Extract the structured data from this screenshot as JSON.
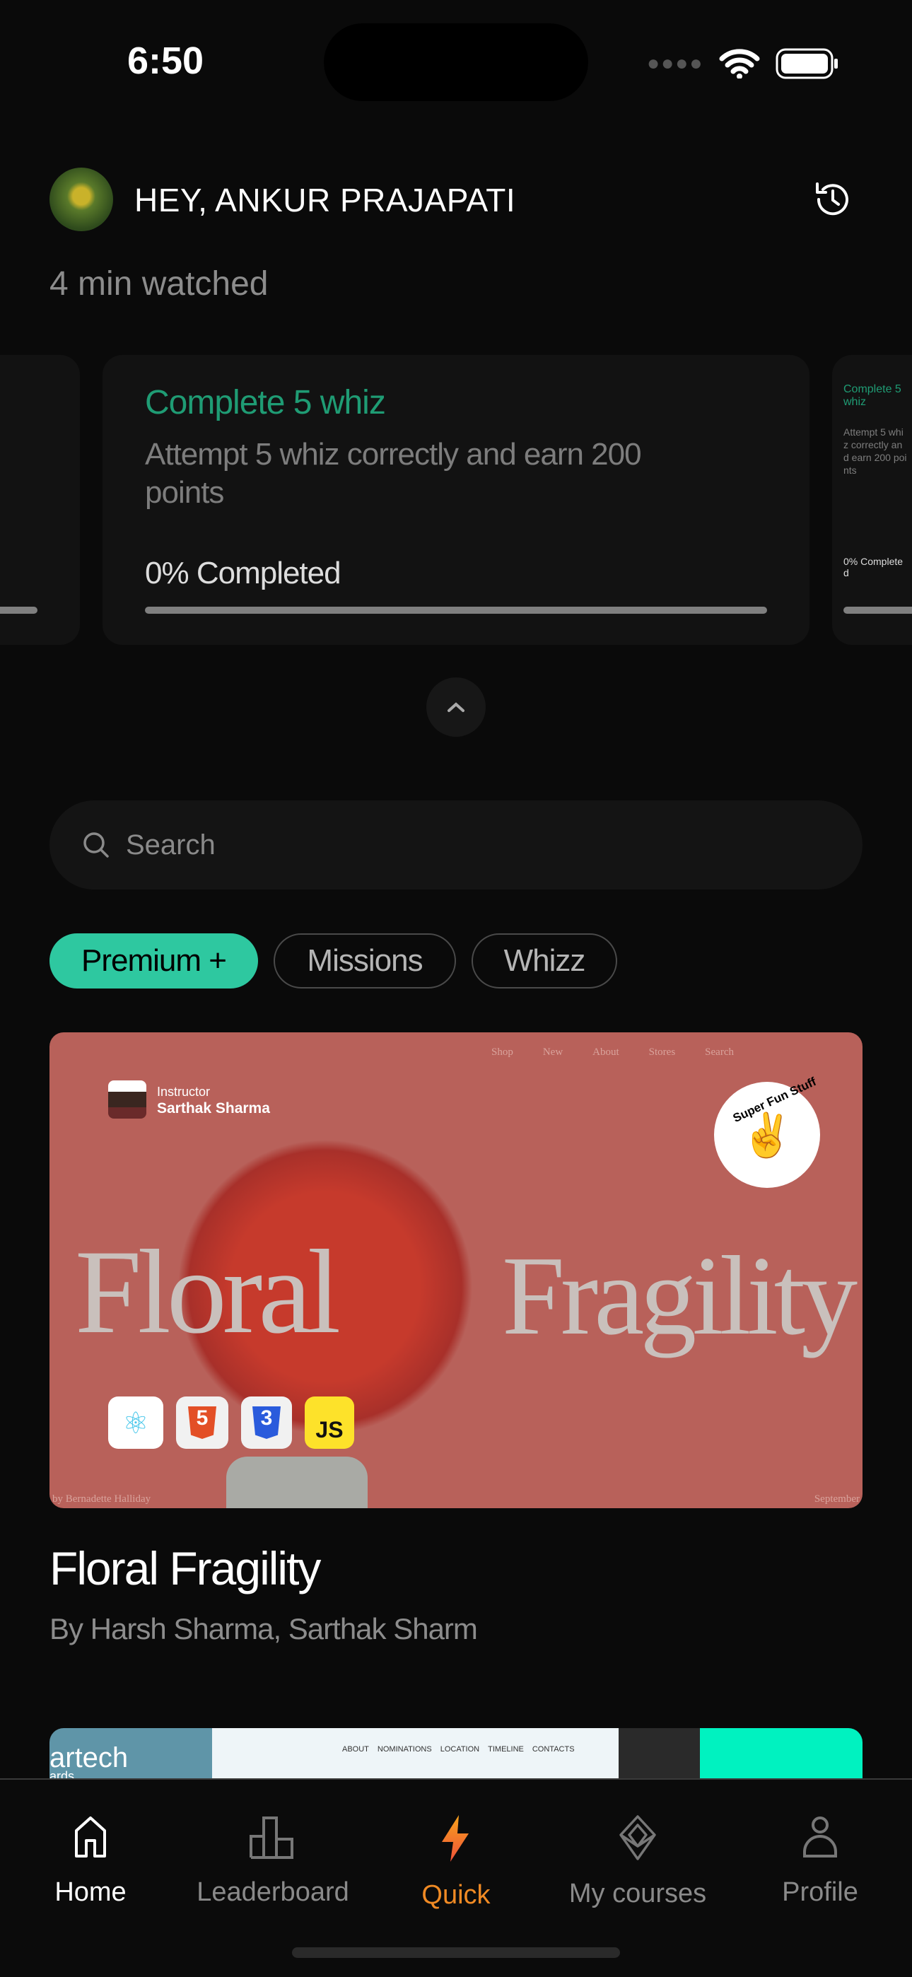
{
  "status_bar": {
    "time": "6:50"
  },
  "header": {
    "greeting": "HEY, ANKUR PRAJAPATI",
    "watched": "4 min  watched",
    "history_icon": "history-icon"
  },
  "missions": [
    {
      "title": "Complete 5 whiz",
      "description": "Attempt 5 whiz correctly and earn 200 points",
      "progress_label": "0%  Completed",
      "progress": 0
    },
    {
      "title": "Complete 5 whiz",
      "description": "Attempt 5 whiz correctly and earn 200 points",
      "progress_label": "0%  Completed",
      "progress": 0
    }
  ],
  "search": {
    "placeholder": "Search"
  },
  "chips": [
    {
      "label": "Premium +",
      "active": true
    },
    {
      "label": "Missions",
      "active": false
    },
    {
      "label": "Whizz",
      "active": false
    }
  ],
  "courses": [
    {
      "title": "Floral Fragility",
      "authors": "By Harsh Sharma, Sarthak Sharm",
      "thumb": {
        "instructor_label": "Instructor",
        "instructor_name": "Sarthak Sharma",
        "hero_left": "Floral",
        "hero_right": "Fragility",
        "nav": [
          "Shop",
          "New",
          "About",
          "Stores",
          "Search"
        ],
        "badge": "Super Fun Stuff",
        "footer_left": "by Bernadette Halliday",
        "footer_right": "September",
        "tech": [
          "React",
          "HTML5",
          "CSS3",
          "JS"
        ]
      }
    },
    {
      "thumb": {
        "brand": "artech",
        "brand_sub": "ards",
        "nav": [
          "ABOUT",
          "NOMINATIONS",
          "LOCATION",
          "TIMELINE",
          "CONTACTS"
        ]
      }
    }
  ],
  "nav": [
    {
      "label": "Home",
      "icon": "home-icon"
    },
    {
      "label": "Leaderboard",
      "icon": "leaderboard-icon"
    },
    {
      "label": "Quick",
      "icon": "bolt-icon"
    },
    {
      "label": "My courses",
      "icon": "cube-icon"
    },
    {
      "label": "Profile",
      "icon": "profile-icon"
    }
  ],
  "colors": {
    "accent_green": "#1f9c74",
    "chip_active": "#2ec8a0",
    "quick_orange": "#f08a24",
    "background": "#0a0a0a"
  }
}
